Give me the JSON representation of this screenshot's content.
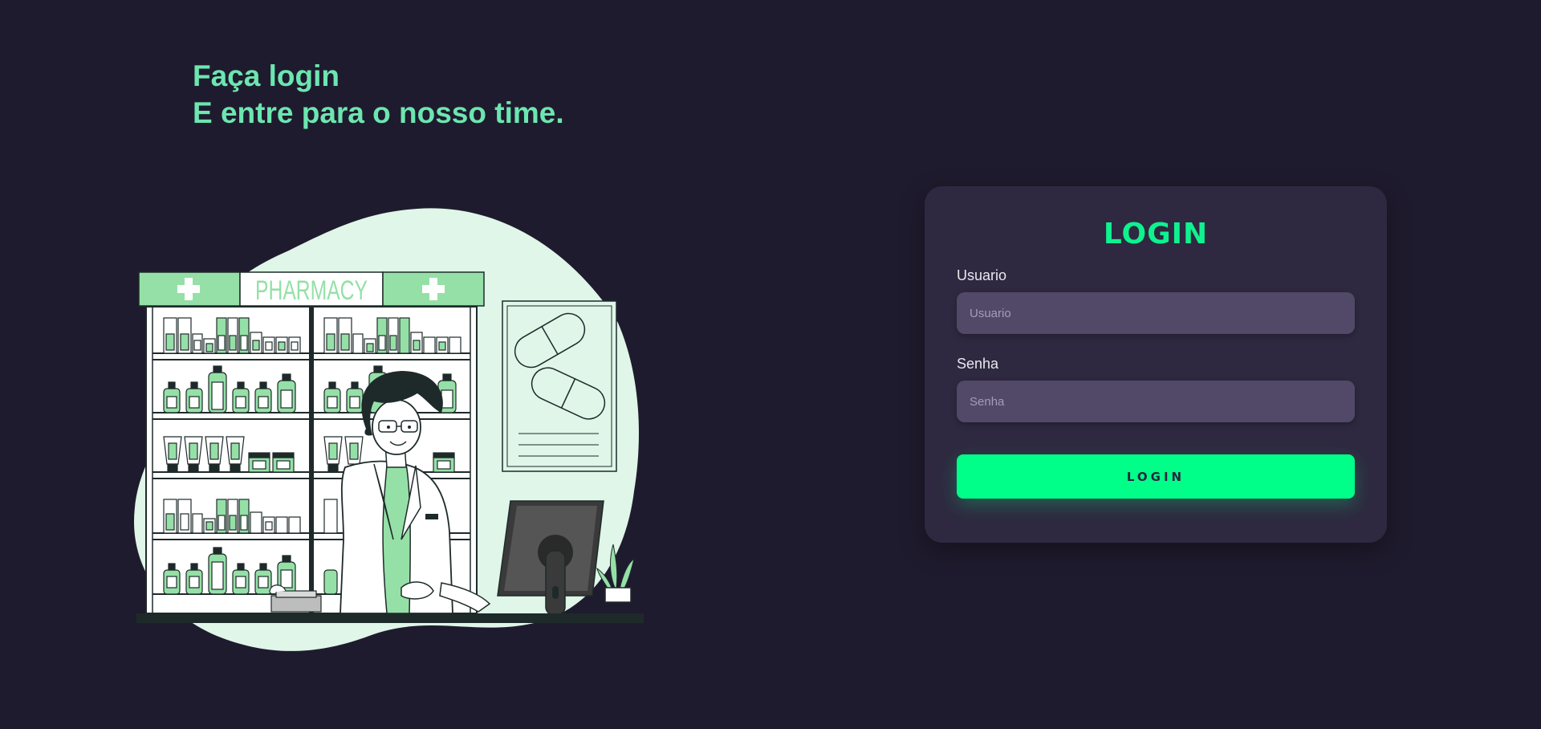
{
  "hero": {
    "line1": "Faça login",
    "line2": "E entre para o nosso time."
  },
  "illustration": {
    "sign_text": "PHARMACY",
    "accent_color": "#6ce6b0"
  },
  "login": {
    "title": "LOGIN",
    "username_label": "Usuario",
    "username_placeholder": "Usuario",
    "username_value": "",
    "password_label": "Senha",
    "password_placeholder": "Senha",
    "password_value": "",
    "button_label": "LOGIN"
  },
  "colors": {
    "background": "#1f1b2e",
    "card": "#2e2940",
    "input": "#524868",
    "brand_green": "#00ff88",
    "headline": "#6ce6b0"
  }
}
